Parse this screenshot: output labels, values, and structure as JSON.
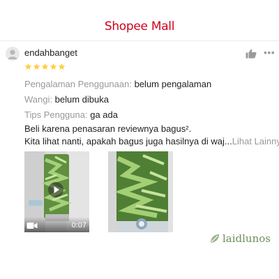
{
  "header": {
    "brand": "Shopee Mall",
    "brand_color": "#d0011b"
  },
  "review": {
    "username": "endahbanget",
    "rating": 5,
    "rating_max": 5,
    "star_color": "#ffce3d",
    "attributes": [
      {
        "key": "Pengalaman Penggunaan:",
        "value": "belum pengalaman"
      },
      {
        "key": "Wangi:",
        "value": "belum dibuka"
      },
      {
        "key": "Tips Pengguna:",
        "value": "ga ada"
      }
    ],
    "body_line1": "Beli karena penasaran reviewnya bagus².",
    "body_line2": "Kita lihat nanti, apakah bagus juga hasilnya di waj...",
    "see_more": "Lihat Lainnya",
    "media": [
      {
        "type": "video",
        "duration": "0:07",
        "icon": "play-icon"
      },
      {
        "type": "image"
      }
    ],
    "icons": {
      "like": "thumbs-up-icon",
      "more": "more-dots-icon",
      "avatar": "user-avatar-icon"
    }
  },
  "watermark": {
    "text": "laidlunos",
    "icon": "leaf-icon",
    "color": "#6f8e58"
  }
}
